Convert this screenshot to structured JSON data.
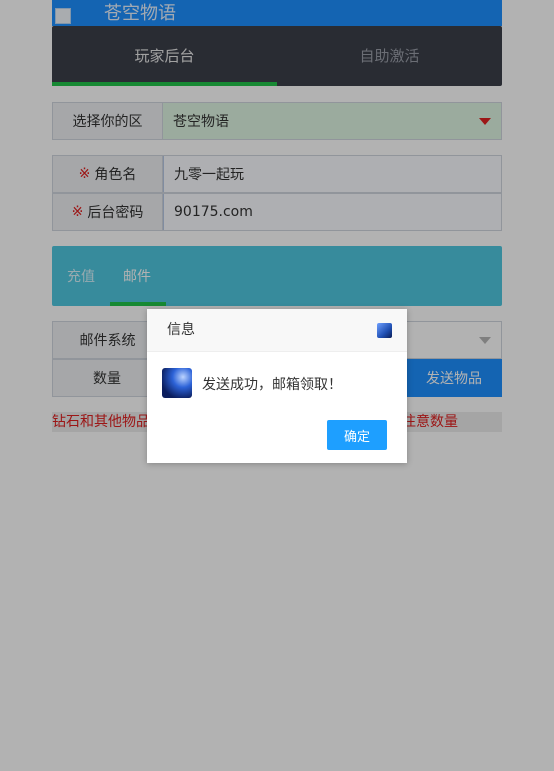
{
  "header": {
    "title": "苍空物语",
    "tabs": [
      "玩家后台",
      "自助激活"
    ]
  },
  "form": {
    "zone": {
      "label": "选择你的区",
      "value": "苍空物语"
    },
    "role": {
      "star": "※",
      "label": "角色名",
      "value": "九零一起玩"
    },
    "password": {
      "star": "※",
      "label": "后台密码",
      "value": "90175.com"
    }
  },
  "subtabs": [
    "充值",
    "邮件"
  ],
  "mail": {
    "system_label": "邮件系统",
    "qty_label": "数量",
    "send_label": "发送物品",
    "notice_left": "钻石和其他物品",
    "notice_right": "注意数量"
  },
  "dialog": {
    "title": "信息",
    "message": "发送成功，邮箱领取！",
    "ok_label": "确定"
  }
}
